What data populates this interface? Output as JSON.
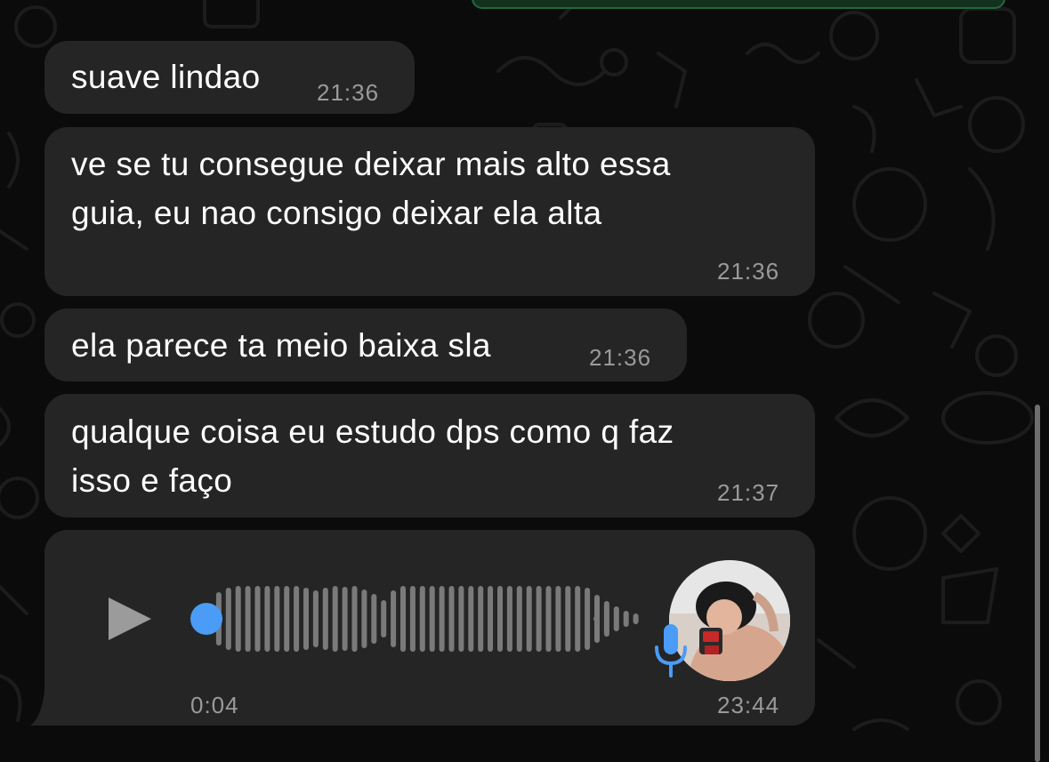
{
  "messages": [
    {
      "text": "suave lindao",
      "time": "21:36"
    },
    {
      "text": "ve se tu consegue deixar mais alto essa\nguia, eu nao consigo deixar ela alta",
      "time": "21:36"
    },
    {
      "text": "ela parece ta meio baixa sla",
      "time": "21:36"
    },
    {
      "text": "qualque coisa eu estudo dps como q faz\nisso e faço",
      "time": "21:37"
    }
  ],
  "voice_note": {
    "duration": "0:04",
    "time": "23:44",
    "progress": 0
  },
  "colors": {
    "background": "#0b0b0b",
    "bubble": "#252525",
    "text": "#ffffff",
    "timestamp": "#9a9a9a",
    "accent": "#4a9cf7",
    "waveform": "#7a7a7a"
  },
  "icons": {
    "play": "play-icon",
    "mic": "microphone-icon",
    "avatar": "avatar"
  }
}
